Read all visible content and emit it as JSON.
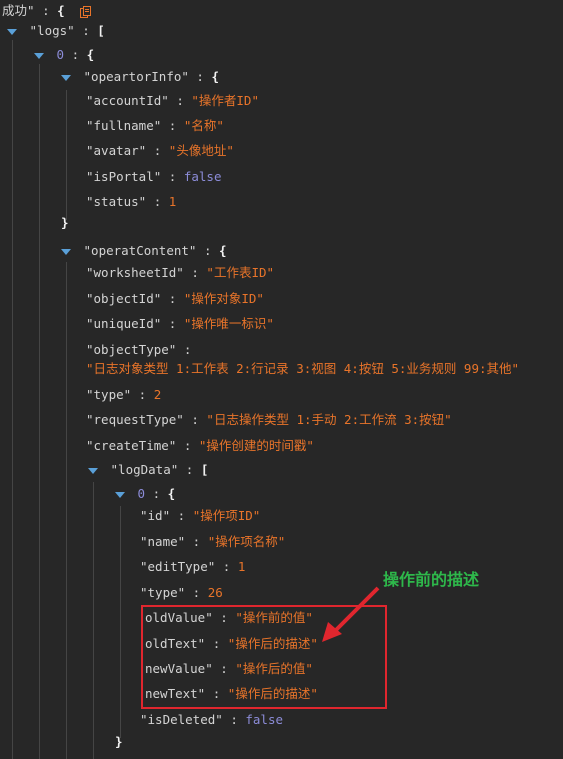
{
  "root": {
    "success_key": "成功\"",
    "colon": ":",
    "open": "{"
  },
  "logs": {
    "key": "\"logs\"",
    "open": "["
  },
  "idx0": {
    "key": "0",
    "open": "{"
  },
  "operatorInfo": {
    "key": "\"opeartorInfo\"",
    "open": "{",
    "accountId": {
      "key": "\"accountId\"",
      "value": "\"操作者ID\""
    },
    "fullname": {
      "key": "\"fullname\"",
      "value": "\"名称\""
    },
    "avatar": {
      "key": "\"avatar\"",
      "value": "\"头像地址\""
    },
    "isPortal": {
      "key": "\"isPortal\"",
      "value": "false"
    },
    "status": {
      "key": "\"status\"",
      "value": "1"
    },
    "close": "}"
  },
  "operatContent": {
    "key": "\"operatContent\"",
    "open": "{",
    "worksheetId": {
      "key": "\"worksheetId\"",
      "value": "\"工作表ID\""
    },
    "objectId": {
      "key": "\"objectId\"",
      "value": "\"操作对象ID\""
    },
    "uniqueId": {
      "key": "\"uniqueId\"",
      "value": "\"操作唯一标识\""
    },
    "objectType": {
      "key": "\"objectType\"",
      "value": "\"日志对象类型 1:工作表 2:行记录 3:视图 4:按钮 5:业务规则 99:其他\""
    },
    "type": {
      "key": "\"type\"",
      "value": "2"
    },
    "requestType": {
      "key": "\"requestType\"",
      "value": "\"日志操作类型 1:手动 2:工作流 3:按钮\""
    },
    "createTime": {
      "key": "\"createTime\"",
      "value": "\"操作创建的时间戳\""
    }
  },
  "logData": {
    "key": "\"logData\"",
    "open": "[",
    "item0": {
      "key": "0",
      "open": "{",
      "close": "}"
    },
    "id": {
      "key": "\"id\"",
      "value": "\"操作项ID\""
    },
    "name": {
      "key": "\"name\"",
      "value": "\"操作项名称\""
    },
    "editType": {
      "key": "\"editType\"",
      "value": "1"
    },
    "type": {
      "key": "\"type\"",
      "value": "26"
    },
    "oldValue": {
      "key": "oldValue\"",
      "value": "\"操作前的值\""
    },
    "oldText": {
      "key": "oldText\"",
      "value": "\"操作后的描述\""
    },
    "newValue": {
      "key": "newValue\"",
      "value": "\"操作后的值\""
    },
    "newText": {
      "key": "newText\"",
      "value": "\"操作后的描述\""
    },
    "isDeleted": {
      "key": "\"isDeleted\"",
      "value": "false"
    }
  },
  "annotation": {
    "text": "操作前的描述",
    "color": "#2eb84b",
    "box_color": "#e0262e"
  },
  "colors": {
    "background": "#272727",
    "string": "#e8742a",
    "boolean": "#8c8cd8",
    "toggle": "#5aa0d8"
  }
}
